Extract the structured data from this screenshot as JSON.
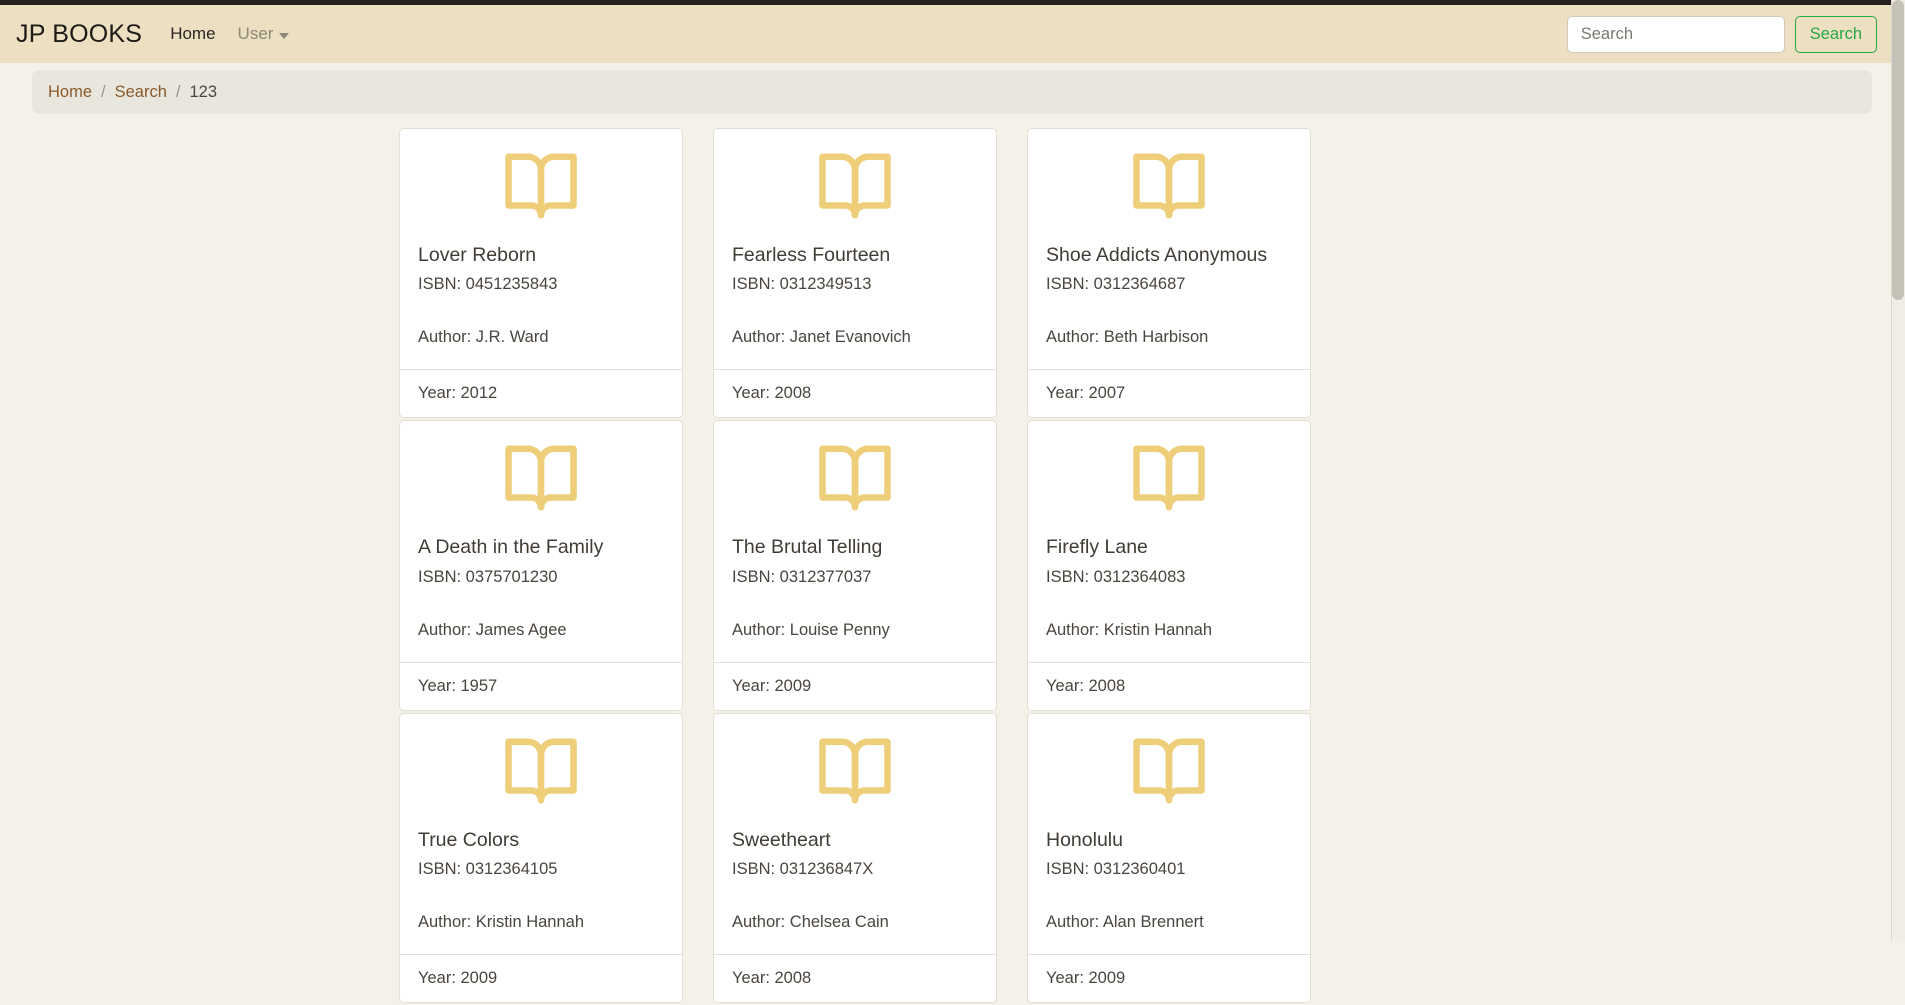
{
  "navbar": {
    "brand": "JP BOOKS",
    "links": [
      {
        "label": "Home",
        "icon": ""
      },
      {
        "label": "User",
        "icon": "chevron-down-icon"
      }
    ],
    "search": {
      "placeholder": "Search",
      "value": "",
      "button_label": "Search",
      "accent_color": "#28a745"
    },
    "background_color": "#ecdfc2"
  },
  "breadcrumb": {
    "items": [
      {
        "label": "Home",
        "active": false
      },
      {
        "label": "Search",
        "active": false
      },
      {
        "label": "123",
        "active": true
      }
    ],
    "separator": "/"
  },
  "labels": {
    "isbn_prefix": "ISBN: ",
    "author_prefix": "Author: ",
    "year_prefix": "Year: "
  },
  "colors": {
    "page_background": "#f4f1e9",
    "book_icon": "#efce7a",
    "card_background": "#ffffff",
    "card_border": "#e2ded4",
    "link": "#8a5a2b"
  },
  "books": [
    {
      "icon": "book-open-icon",
      "title": "Lover Reborn",
      "isbn": "ISBN: 0451235843",
      "author": "Author: J.R. Ward",
      "year": "Year: 2012"
    },
    {
      "icon": "book-open-icon",
      "title": "Fearless Fourteen",
      "isbn": "ISBN: 0312349513",
      "author": "Author: Janet Evanovich",
      "year": "Year: 2008"
    },
    {
      "icon": "book-open-icon",
      "title": "Shoe Addicts Anonymous",
      "isbn": "ISBN: 0312364687",
      "author": "Author: Beth Harbison",
      "year": "Year: 2007"
    },
    {
      "icon": "book-open-icon",
      "title": "A Death in the Family",
      "isbn": "ISBN: 0375701230",
      "author": "Author: James Agee",
      "year": "Year: 1957"
    },
    {
      "icon": "book-open-icon",
      "title": "The Brutal Telling",
      "isbn": "ISBN: 0312377037",
      "author": "Author: Louise Penny",
      "year": "Year: 2009"
    },
    {
      "icon": "book-open-icon",
      "title": "Firefly Lane",
      "isbn": "ISBN: 0312364083",
      "author": "Author: Kristin Hannah",
      "year": "Year: 2008"
    },
    {
      "icon": "book-open-icon",
      "title": "True Colors",
      "isbn": "ISBN: 0312364105",
      "author": "Author: Kristin Hannah",
      "year": "Year: 2009"
    },
    {
      "icon": "book-open-icon",
      "title": "Sweetheart",
      "isbn": "ISBN: 031236847X",
      "author": "Author: Chelsea Cain",
      "year": "Year: 2008"
    },
    {
      "icon": "book-open-icon",
      "title": "Honolulu",
      "isbn": "ISBN: 0312360401",
      "author": "Author: Alan Brennert",
      "year": "Year: 2009"
    }
  ]
}
